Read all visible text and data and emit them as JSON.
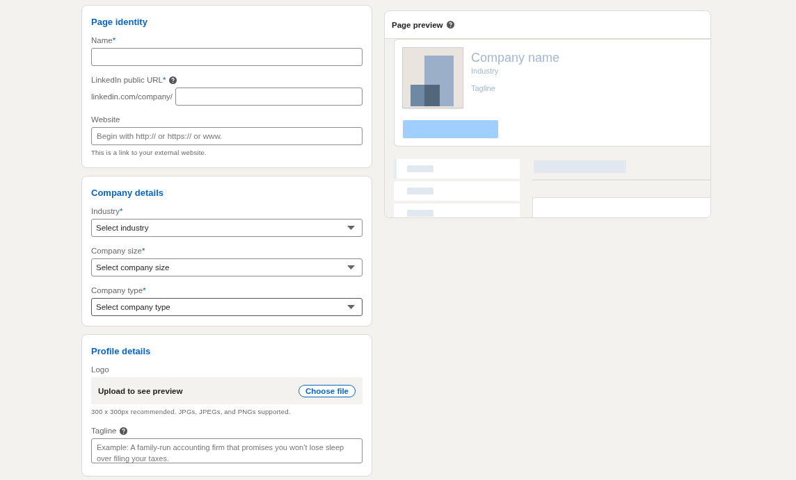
{
  "sections": [
    {
      "title": "Page identity",
      "fields": [
        {
          "kind": "text",
          "label": "Name",
          "required_mark": "*"
        },
        {
          "kind": "prefixed",
          "label": "LinkedIn public URL",
          "required_mark": "*",
          "help": true,
          "prefix": "linkedin.com/company/"
        },
        {
          "kind": "text",
          "label": "Website",
          "placeholder": "Begin with http:// or https:// or www.",
          "hint": "This is a link to your external website."
        }
      ]
    },
    {
      "title": "Company details",
      "fields": [
        {
          "kind": "select",
          "label": "Industry",
          "required_mark": "*",
          "value": "Select industry",
          "focused": false
        },
        {
          "kind": "select",
          "label": "Company size",
          "required_mark": "*",
          "value": "Select company size",
          "focused": false
        },
        {
          "kind": "select",
          "label": "Company type",
          "required_mark": "*",
          "value": "Select company type",
          "focused": true
        }
      ]
    },
    {
      "title": "Profile details",
      "fields": [
        {
          "kind": "upload",
          "label": "Logo",
          "text": "Upload to see preview",
          "button": "Choose file",
          "hint": "300 x 300px recommended. JPGs, JPEGs, and PNGs supported."
        },
        {
          "kind": "textarea",
          "label": "Tagline",
          "help": true,
          "placeholder": "Example: A family-run accounting firm that promises you won’t lose sleep over filing your taxes."
        }
      ]
    }
  ],
  "preview": {
    "title": "Page preview",
    "help": true,
    "company_name": "Company name",
    "industry": "Industry",
    "tagline": "Tagline"
  }
}
